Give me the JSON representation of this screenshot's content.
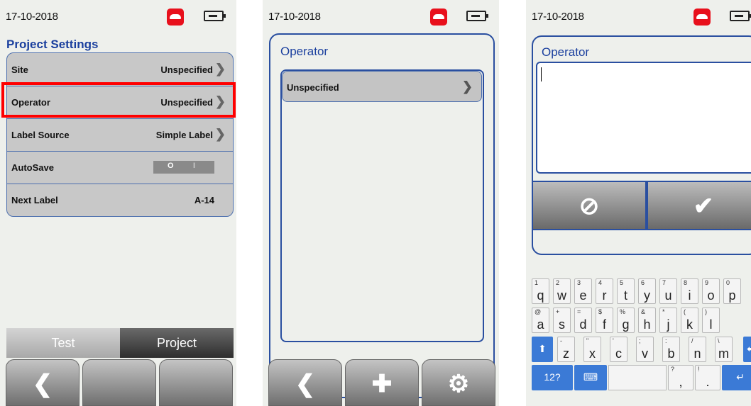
{
  "screen1": {
    "date": "17-10-2018",
    "title": "Project Settings",
    "rows": [
      {
        "label": "Site",
        "value": "Unspecified"
      },
      {
        "label": "Operator",
        "value": "Unspecified"
      },
      {
        "label": "Label Source",
        "value": "Simple Label"
      },
      {
        "label": "AutoSave",
        "toggle_on": "O",
        "toggle_off": "I"
      },
      {
        "label": "Next Label",
        "value": "A-14"
      }
    ],
    "tabs": {
      "test": "Test",
      "project": "Project"
    }
  },
  "screen2": {
    "date": "17-10-2018",
    "title": "Operator",
    "item": "Unspecified"
  },
  "screen3": {
    "date": "17-10-2018",
    "title": "Operator",
    "keyboard": {
      "row1": [
        {
          "k": "q",
          "s": "1"
        },
        {
          "k": "w",
          "s": "2"
        },
        {
          "k": "e",
          "s": "3"
        },
        {
          "k": "r",
          "s": "4"
        },
        {
          "k": "t",
          "s": "5"
        },
        {
          "k": "y",
          "s": "6"
        },
        {
          "k": "u",
          "s": "7"
        },
        {
          "k": "i",
          "s": "8"
        },
        {
          "k": "o",
          "s": "9"
        },
        {
          "k": "p",
          "s": "0"
        }
      ],
      "row2": [
        {
          "k": "a",
          "s": "@"
        },
        {
          "k": "s",
          "s": "+"
        },
        {
          "k": "d",
          "s": "="
        },
        {
          "k": "f",
          "s": "$"
        },
        {
          "k": "g",
          "s": "%"
        },
        {
          "k": "h",
          "s": "&"
        },
        {
          "k": "j",
          "s": "*"
        },
        {
          "k": "k",
          "s": "("
        },
        {
          "k": "l",
          "s": ")"
        }
      ],
      "row3": [
        {
          "k": "z",
          "s": "-"
        },
        {
          "k": "x",
          "s": "\""
        },
        {
          "k": "c",
          "s": "'"
        },
        {
          "k": "v",
          "s": ";"
        },
        {
          "k": "b",
          "s": ":"
        },
        {
          "k": "n",
          "s": "/"
        },
        {
          "k": "m",
          "s": "\\"
        }
      ],
      "mode_label": "12?",
      "comma_label": ",",
      "comma_sub": "?",
      "period_label": ".",
      "period_sub": "!"
    }
  }
}
